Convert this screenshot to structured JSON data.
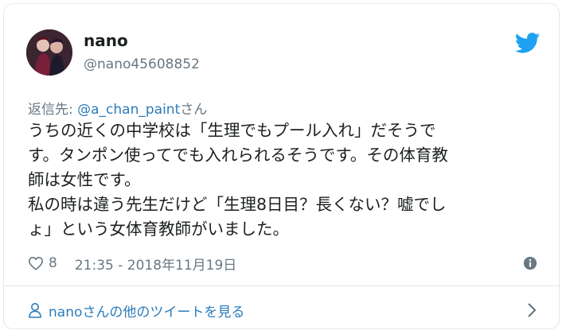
{
  "tweet": {
    "user": {
      "name": "nano",
      "handle": "@nano45608852"
    },
    "reply_prefix": "返信先: ",
    "reply_handle": "@a_chan_paint",
    "reply_suffix": "さん",
    "lines": [
      "うちの近くの中学校は「生理でもプール入れ」だそうで",
      "す。タンポン使ってでも入れられるそうです。その体育教",
      "師は女性です。",
      "私の時は違う先生だけど「生理8日目？長くない？嘘でし",
      "ょ」という女体育教師がいました。"
    ],
    "likes": "8",
    "timestamp": "21:35 - 2018年11月19日"
  },
  "footer": {
    "more_label": "nanoさんの他のツイートを見る"
  },
  "colors": {
    "accent": "#2b7bb9",
    "bird": "#1da1f2",
    "muted": "#697882"
  },
  "icons": [
    "bird-icon",
    "heart-icon",
    "info-icon",
    "person-icon",
    "chevron-right-icon"
  ]
}
